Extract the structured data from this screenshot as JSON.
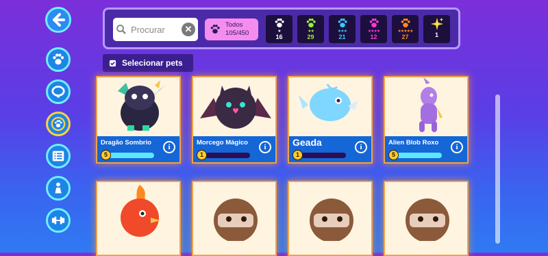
{
  "search": {
    "placeholder": "Procurar"
  },
  "filter_all": {
    "label": "Todos",
    "count": "105/450"
  },
  "rarity_filters": [
    {
      "stars": "★",
      "count": "16",
      "color": "#ffffff"
    },
    {
      "stars": "★★",
      "count": "29",
      "color": "#9cf03a"
    },
    {
      "stars": "★★★",
      "count": "21",
      "color": "#3ac8ff"
    },
    {
      "stars": "★★★★",
      "count": "12",
      "color": "#ff3ad8"
    },
    {
      "stars": "★★★★★",
      "count": "27",
      "color": "#ff8a1f"
    },
    {
      "stars": "",
      "count": "1",
      "color": "#ffe23a"
    }
  ],
  "select_button": "Selecionar pets",
  "pets": [
    {
      "name": "Dragão Sombrio",
      "level": "5",
      "xp_fraction": 1.0
    },
    {
      "name": "Morcego Mágico",
      "level": "1",
      "xp_fraction": 0.0
    },
    {
      "name": "Geada",
      "level": "1",
      "xp_fraction": 0.0
    },
    {
      "name": "Alien Blob Roxo",
      "level": "5",
      "xp_fraction": 1.0
    }
  ],
  "sidebar": [
    "paw-icon",
    "collar-icon",
    "paw-ring-icon",
    "list-icon",
    "person-icon",
    "dumbbell-icon"
  ]
}
